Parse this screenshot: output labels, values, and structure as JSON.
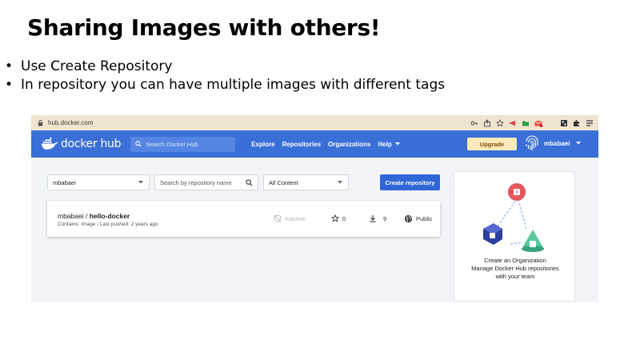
{
  "slide": {
    "title": "Sharing Images with others!",
    "bullets": [
      "Use Create Repository",
      "In repository you can have multiple images with different tags"
    ]
  },
  "browser": {
    "url": "hub.docker.com",
    "extension_icons": [
      "key-icon",
      "share-icon",
      "star-icon",
      "megaphone-icon",
      "folder-icon",
      "gmail-icon",
      "extension-icon",
      "qr-icon",
      "puzzle-icon",
      "menu-icon"
    ]
  },
  "nav": {
    "logo_text": "docker hub",
    "search_placeholder": "Search Docker Hub",
    "links": [
      "Explore",
      "Repositories",
      "Organizations",
      "Help"
    ],
    "upgrade_label": "Upgrade",
    "username": "mbabaei"
  },
  "filters": {
    "namespace": "mbabaei",
    "repo_search_placeholder": "Search by repository name",
    "content_filter": "All Content"
  },
  "create_repository_label": "Create repository",
  "repository": {
    "owner": "mbabaei",
    "name": "hello-docker",
    "contains": "Contains: Image",
    "last_pushed": "Last pushed: 2 years ago",
    "status": "Inactive",
    "stars": "0",
    "pulls": "9",
    "visibility": "Public"
  },
  "org_promo": {
    "line1": "Create an Organization",
    "line2": "Manage Docker Hub repositories",
    "line3": "with your team"
  },
  "colors": {
    "nav_blue": "#3a6fd8",
    "button_blue": "#2f67d8",
    "upgrade_bg": "#fde9bb",
    "browser_bar": "#efe4cf"
  }
}
